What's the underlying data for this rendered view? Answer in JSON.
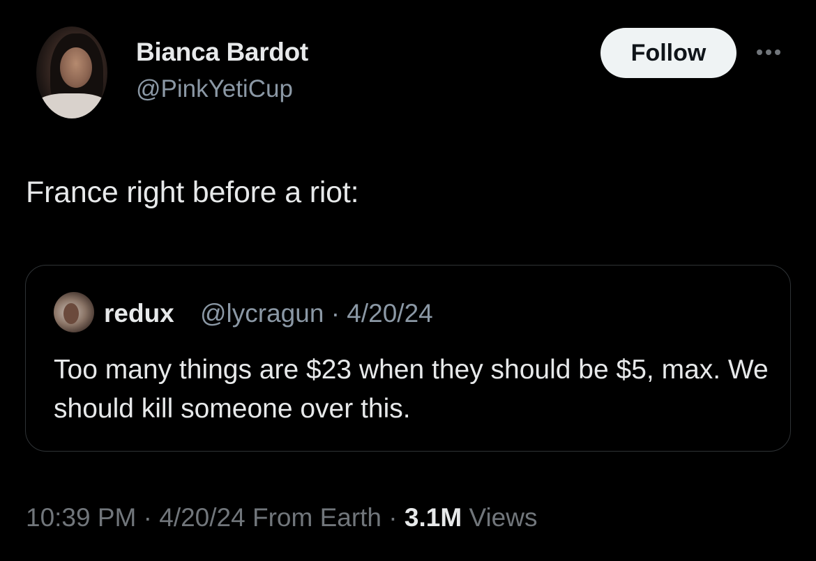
{
  "author": {
    "display_name": "Bianca Bardot",
    "handle": "@PinkYetiCup"
  },
  "actions": {
    "follow_label": "Follow",
    "more_icon": "more-horizontal-icon"
  },
  "tweet": {
    "text": "France right before a riot:"
  },
  "quote": {
    "display_name": "redux",
    "meta": "@lycragun · 4/20/24",
    "text": "Too many things are $23 when they should be $5, max. We should kill someone over this."
  },
  "footer": {
    "timestamp": "10:39 PM · 4/20/24 From Earth · ",
    "views_count": "3.1M",
    "views_label": " Views"
  },
  "colors": {
    "background": "#000000",
    "primary_text": "#e7e9ea",
    "secondary_text": "#8b98a5",
    "border": "#2f3336",
    "follow_bg": "#eff3f4"
  }
}
